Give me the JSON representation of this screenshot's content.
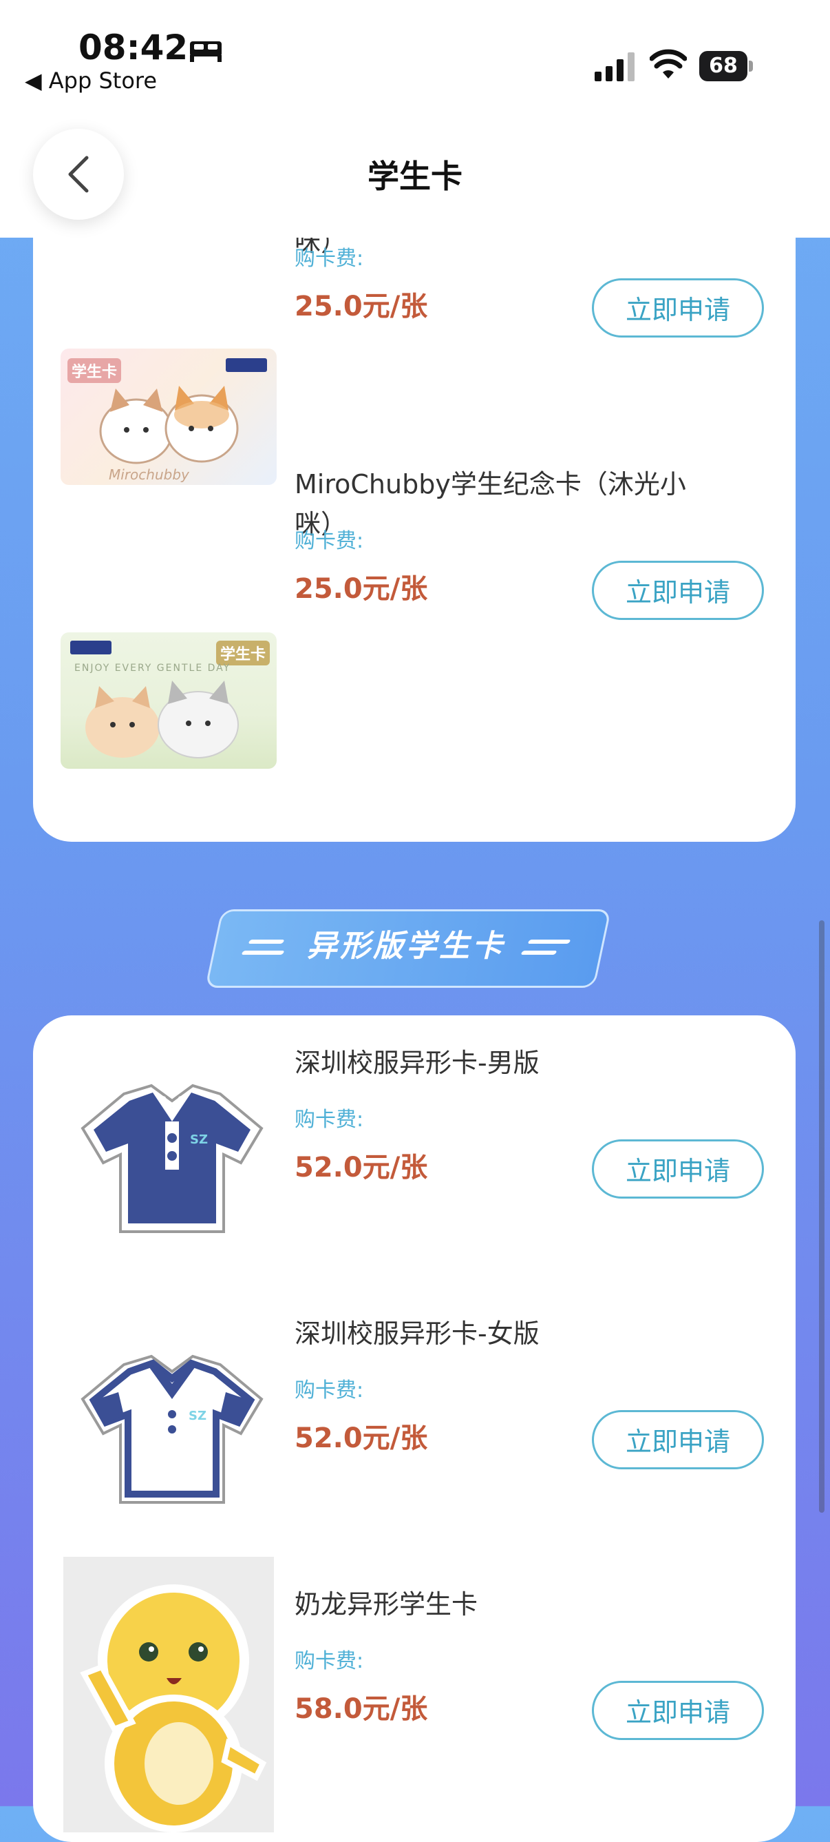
{
  "status_bar": {
    "time": "08:42",
    "back_app": "◀ App Store",
    "battery": "68"
  },
  "header": {
    "title": "学生卡"
  },
  "section_heading": "异形版学生卡",
  "cards_top": [
    {
      "name": "MiroChubby学生纪念卡（巧手小咪）",
      "fee_label": "购卡费:",
      "price": "25.0元/张",
      "button": "立即申请",
      "thumb_text": "学生卡"
    },
    {
      "name": "MiroChubby学生纪念卡（沐光小咪）",
      "fee_label": "购卡费:",
      "price": "25.0元/张",
      "button": "立即申请",
      "thumb_text": "学生卡",
      "thumb_sub": "ENJOY EVERY GENTLE DAY"
    }
  ],
  "cards_shaped": [
    {
      "name": "深圳校服异形卡-男版",
      "fee_label": "购卡费:",
      "price": "52.0元/张",
      "button": "立即申请",
      "logo": "SZ"
    },
    {
      "name": "深圳校服异形卡-女版",
      "fee_label": "购卡费:",
      "price": "52.0元/张",
      "button": "立即申请",
      "logo": "SZ"
    },
    {
      "name": "奶龙异形学生卡",
      "fee_label": "购卡费:",
      "price": "58.0元/张",
      "button": "立即申请"
    }
  ]
}
